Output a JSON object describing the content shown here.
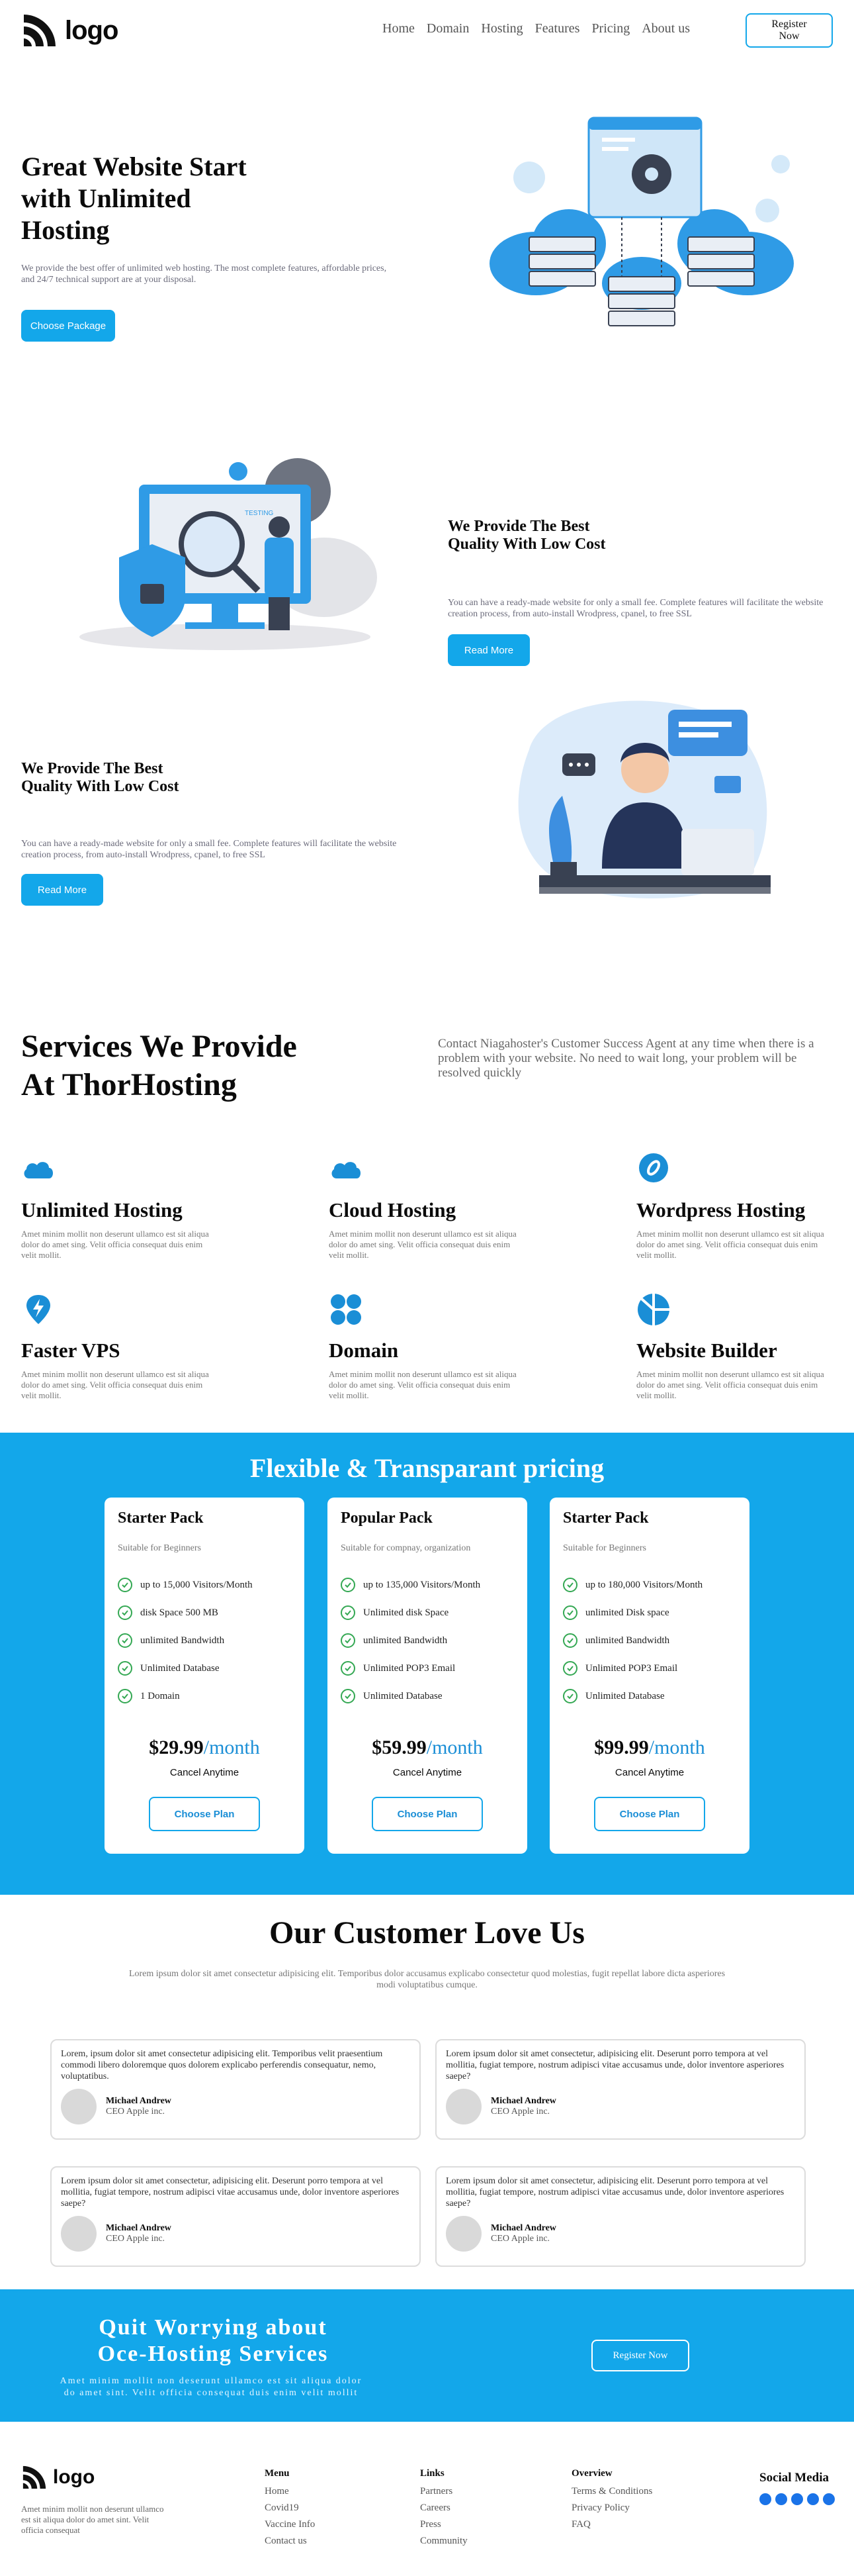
{
  "header": {
    "logo_text": "logo",
    "nav": [
      "Home",
      "Domain",
      "Hosting",
      "Features",
      "Pricing",
      "About us"
    ],
    "register_label": "Register Now"
  },
  "hero": {
    "title_line1": "Great Website Start",
    "title_line2": "with Unlimited",
    "title_line3": "Hosting",
    "desc": "We provide the best offer of unlimited web hosting. The most complete features, affordable prices, and 24/7 technical support are at your disposal.",
    "cta": "Choose Package"
  },
  "feature1": {
    "title_line1": "We Provide The Best",
    "title_line2": "Quality With Low Cost",
    "desc": "You can have a ready-made website for only a small fee. Complete features will facilitate the website creation process, from auto-install Wrodpress, cpanel, to free SSL",
    "cta": "Read More",
    "screen_label": "TESTING"
  },
  "feature2": {
    "title_line1": "We Provide The Best",
    "title_line2": "Quality With Low Cost",
    "desc": "You can have a ready-made website for only a small fee. Complete features will facilitate the website creation process, from auto-install Wrodpress, cpanel, to free SSL",
    "cta": "Read More"
  },
  "services": {
    "title_line1": "Services We Provide",
    "title_line2": "At ThorHosting",
    "intro": "Contact Niagahoster's Customer Success Agent at any time when there is a problem with your website. No need to wait long, your problem will be resolved quickly",
    "items": [
      {
        "title": "Unlimited Hosting",
        "desc": "Amet minim mollit non deserunt ullamco est sit aliqua dolor do amet sing. Velit officia consequat duis enim velit mollit."
      },
      {
        "title": "Cloud Hosting",
        "desc": "Amet minim mollit non deserunt ullamco est sit aliqua dolor do amet sing. Velit officia consequat duis enim velit mollit."
      },
      {
        "title": "Wordpress Hosting",
        "desc": "Amet minim mollit non deserunt ullamco est sit aliqua dolor do amet sing. Velit officia consequat duis enim velit mollit."
      },
      {
        "title": "Faster VPS",
        "desc": "Amet minim mollit non deserunt ullamco est sit aliqua dolor do amet sing. Velit officia consequat duis enim velit mollit."
      },
      {
        "title": "Domain",
        "desc": "Amet minim mollit non deserunt ullamco est sit aliqua dolor do amet sing. Velit officia consequat duis enim velit mollit."
      },
      {
        "title": "Website Builder",
        "desc": "Amet minim mollit non deserunt ullamco est sit aliqua dolor do amet sing. Velit officia consequat duis enim velit mollit."
      }
    ]
  },
  "pricing": {
    "title": "Flexible & Transparant pricing",
    "plans": [
      {
        "name": "Starter Pack",
        "sub": "Suitable for Beginners",
        "features": [
          "up to 15,000 Visitors/Month",
          "disk Space 500 MB",
          "unlimited Bandwidth",
          "Unlimited Database",
          "1 Domain"
        ],
        "price": "$29.99",
        "per": "/month",
        "cancel": "Cancel Anytime",
        "cta": "Choose Plan"
      },
      {
        "name": "Popular Pack",
        "sub": "Suitable for compnay, organization",
        "features": [
          "up to 135,000 Visitors/Month",
          "Unlimited disk Space",
          "unlimited Bandwidth",
          "Unlimited POP3 Email",
          "Unlimited Database"
        ],
        "price": "$59.99",
        "per": "/month",
        "cancel": "Cancel Anytime",
        "cta": "Choose Plan"
      },
      {
        "name": "Starter Pack",
        "sub": "Suitable for Beginners",
        "features": [
          "up to 180,000 Visitors/Month",
          "unlimited Disk space",
          "unlimited Bandwidth",
          "Unlimited POP3 Email",
          "Unlimited Database"
        ],
        "price": "$99.99",
        "per": "/month",
        "cancel": "Cancel Anytime",
        "cta": "Choose Plan"
      }
    ]
  },
  "testimonials": {
    "title": "Our Customer Love Us",
    "sub": "Lorem ipsum dolor sit amet consectetur adipisicing elit. Temporibus dolor accusamus explicabo consectetur quod molestias, fugit repellat labore dicta asperiores modi voluptatibus cumque.",
    "items": [
      {
        "text": "Lorem, ipsum dolor sit amet consectetur adipisicing elit. Temporibus velit praesentium commodi libero doloremque quos dolorem explicabo perferendis consequatur, nemo, voluptatibus.",
        "name": "Michael Andrew",
        "role": "CEO Apple inc."
      },
      {
        "text": "Lorem ipsum dolor sit amet consectetur, adipisicing elit. Deserunt porro tempora at vel mollitia, fugiat tempore, nostrum adipisci vitae accusamus unde, dolor inventore asperiores saepe?",
        "name": "Michael Andrew",
        "role": "CEO Apple inc."
      },
      {
        "text": "Lorem ipsum dolor sit amet consectetur, adipisicing elit. Deserunt porro tempora at vel mollitia, fugiat tempore, nostrum adipisci vitae accusamus unde, dolor inventore asperiores saepe?",
        "name": "Michael Andrew",
        "role": "CEO Apple inc."
      },
      {
        "text": "Lorem ipsum dolor sit amet consectetur, adipisicing elit. Deserunt porro tempora at vel mollitia, fugiat tempore, nostrum adipisci vitae accusamus unde, dolor inventore asperiores saepe?",
        "name": "Michael Andrew",
        "role": "CEO Apple inc."
      }
    ]
  },
  "cta": {
    "title_line1": "Quit Worrying about",
    "title_line2": "Oce-Hosting Services",
    "desc": "Amet minim mollit non deserunt ullamco est sit aliqua dolor do amet sint. Velit officia consequat duis enim velit mollit",
    "button": "Register Now"
  },
  "footer": {
    "logo_text": "logo",
    "about": "Amet minim mollit non deserunt ullamco est sit aliqua dolor do amet sint. Velit officia consequat",
    "menu_title": "Menu",
    "menu": [
      "Home",
      "Covid19",
      "Vaccine Info",
      "Contact us"
    ],
    "links_title": "Links",
    "links": [
      "Partners",
      "Careers",
      "Press",
      "Community"
    ],
    "overview_title": "Overview",
    "overview": [
      "Terms & Conditions",
      "Privacy Policy",
      "FAQ"
    ],
    "social_title": "Social Media"
  },
  "colors": {
    "accent": "#13a7ea",
    "accent_dark": "#1a8ed6",
    "check": "#34a853",
    "text": "#0b0b0b"
  }
}
